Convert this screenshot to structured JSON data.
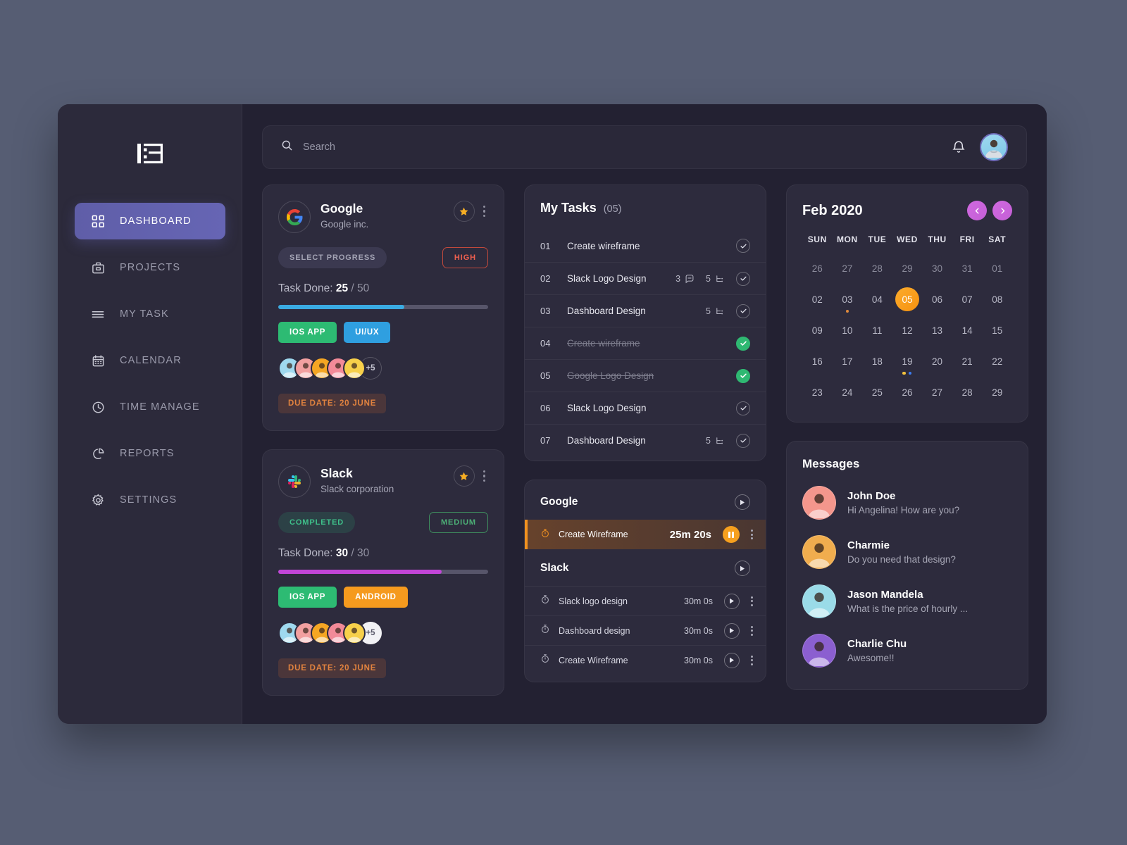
{
  "sidebar": {
    "logo_name": "logo-13",
    "items": [
      {
        "label": "DASHBOARD",
        "icon": "grid-icon",
        "active": true
      },
      {
        "label": "PROJECTS",
        "icon": "briefcase-icon",
        "active": false
      },
      {
        "label": "MY TASK",
        "icon": "list-icon",
        "active": false
      },
      {
        "label": "CALENDAR",
        "icon": "calendar-icon",
        "active": false
      },
      {
        "label": "TIME MANAGE",
        "icon": "clock-icon",
        "active": false
      },
      {
        "label": "REPORTS",
        "icon": "pie-chart-icon",
        "active": false
      },
      {
        "label": "SETTINGS",
        "icon": "gear-icon",
        "active": false
      }
    ]
  },
  "topbar": {
    "search_placeholder": "Search",
    "search_value": "",
    "bell_icon": "bell-icon",
    "avatar_name": "user-avatar"
  },
  "projects": [
    {
      "name": "Google",
      "company": "Google inc.",
      "logo": "google-logo",
      "status_label": "SELECT PROGRESS",
      "status_kind": "select",
      "priority_label": "HIGH",
      "priority_kind": "high",
      "task_done_label": "Task Done:",
      "done": "25",
      "total": "/ 50",
      "progress_pct": 60,
      "progress_color": "#3aabe2",
      "tags": [
        {
          "label": "IOS APP",
          "color": "#2dbb73"
        },
        {
          "label": "UI/UX",
          "color": "#2f9fe0"
        }
      ],
      "avatars": [
        {
          "color": "#9fd9ef",
          "name": "member-avatar"
        },
        {
          "color": "#f2a0a0",
          "name": "member-avatar"
        },
        {
          "color": "#f5a623",
          "name": "member-avatar"
        },
        {
          "color": "#f28a98",
          "name": "member-avatar"
        },
        {
          "color": "#f7d04a",
          "name": "member-avatar"
        }
      ],
      "avatar_more": "+5",
      "avatar_more_light": false,
      "due_date": "DUE DATE: 20 JUNE"
    },
    {
      "name": "Slack",
      "company": "Slack corporation",
      "logo": "slack-logo",
      "status_label": "COMPLETED",
      "status_kind": "completed",
      "priority_label": "MEDIUM",
      "priority_kind": "medium",
      "task_done_label": "Task Done:",
      "done": "30",
      "total": "/ 30",
      "progress_pct": 78,
      "progress_color": "#c245d8",
      "tags": [
        {
          "label": "IOS APP",
          "color": "#2dbb73"
        },
        {
          "label": "ANDROID",
          "color": "#f59a1e"
        }
      ],
      "avatars": [
        {
          "color": "#9fd9ef",
          "name": "member-avatar"
        },
        {
          "color": "#f2a0a0",
          "name": "member-avatar"
        },
        {
          "color": "#f5a623",
          "name": "member-avatar"
        },
        {
          "color": "#f28a98",
          "name": "member-avatar"
        },
        {
          "color": "#f7d04a",
          "name": "member-avatar"
        }
      ],
      "avatar_more": "+5",
      "avatar_more_light": true,
      "due_date": "DUE DATE: 20 JUNE"
    }
  ],
  "my_tasks": {
    "title": "My Tasks",
    "count": "(05)",
    "rows": [
      {
        "num": "01",
        "name": "Create wireframe",
        "comments": "",
        "subtasks": "",
        "done": false
      },
      {
        "num": "02",
        "name": "Slack Logo Design",
        "comments": "3",
        "subtasks": "5",
        "done": false
      },
      {
        "num": "03",
        "name": "Dashboard Design",
        "comments": "",
        "subtasks": "5",
        "done": false
      },
      {
        "num": "04",
        "name": "Create wireframe",
        "comments": "",
        "subtasks": "",
        "done": true
      },
      {
        "num": "05",
        "name": "Google Logo Design",
        "comments": "",
        "subtasks": "",
        "done": true
      },
      {
        "num": "06",
        "name": "Slack Logo Design",
        "comments": "",
        "subtasks": "",
        "done": false
      },
      {
        "num": "07",
        "name": "Dashboard Design",
        "comments": "",
        "subtasks": "5",
        "done": false
      }
    ]
  },
  "timer": {
    "groups": [
      {
        "name": "Google",
        "rows": [
          {
            "name": "Create Wireframe",
            "time": "25m 20s",
            "state": "running"
          }
        ]
      },
      {
        "name": "Slack",
        "rows": [
          {
            "name": "Slack logo design",
            "time": "30m 0s",
            "state": "paused"
          },
          {
            "name": "Dashboard design",
            "time": "30m 0s",
            "state": "paused"
          },
          {
            "name": "Create Wireframe",
            "time": "30m 0s",
            "state": "paused"
          }
        ]
      }
    ]
  },
  "calendar": {
    "title": "Feb 2020",
    "prev_icon": "chevron-left-icon",
    "next_icon": "chevron-right-icon",
    "dow": [
      "SUN",
      "MON",
      "TUE",
      "WED",
      "THU",
      "FRI",
      "SAT"
    ],
    "weeks": [
      [
        {
          "d": "26",
          "muted": true
        },
        {
          "d": "27",
          "muted": true
        },
        {
          "d": "28",
          "muted": true
        },
        {
          "d": "29",
          "muted": true
        },
        {
          "d": "30",
          "muted": true
        },
        {
          "d": "31",
          "muted": true
        },
        {
          "d": "01",
          "muted": true
        }
      ],
      [
        {
          "d": "02"
        },
        {
          "d": "03",
          "dots": [
            "#e08a3c"
          ]
        },
        {
          "d": "04"
        },
        {
          "d": "05",
          "today": true
        },
        {
          "d": "06"
        },
        {
          "d": "07"
        },
        {
          "d": "08"
        }
      ],
      [
        {
          "d": "09"
        },
        {
          "d": "10"
        },
        {
          "d": "11"
        },
        {
          "d": "12"
        },
        {
          "d": "13"
        },
        {
          "d": "14"
        },
        {
          "d": "15"
        }
      ],
      [
        {
          "d": "16"
        },
        {
          "d": "17"
        },
        {
          "d": "18"
        },
        {
          "d": "19",
          "dots": [
            "#f2c13d",
            "#3d7df2"
          ]
        },
        {
          "d": "20"
        },
        {
          "d": "21"
        },
        {
          "d": "22"
        }
      ],
      [
        {
          "d": "23"
        },
        {
          "d": "24"
        },
        {
          "d": "25"
        },
        {
          "d": "26"
        },
        {
          "d": "27"
        },
        {
          "d": "28"
        },
        {
          "d": "29"
        }
      ]
    ]
  },
  "messages": {
    "title": "Messages",
    "items": [
      {
        "name": "John Doe",
        "text": "Hi Angelina! How are you?",
        "color": "#f4968c"
      },
      {
        "name": "Charmie",
        "text": "Do you need that design?",
        "color": "#f0ad4e"
      },
      {
        "name": "Jason Mandela",
        "text": "What is the price of hourly ...",
        "color": "#9adbe8"
      },
      {
        "name": "Charlie Chu",
        "text": "Awesome!!",
        "color": "#8b5fd0"
      }
    ]
  }
}
